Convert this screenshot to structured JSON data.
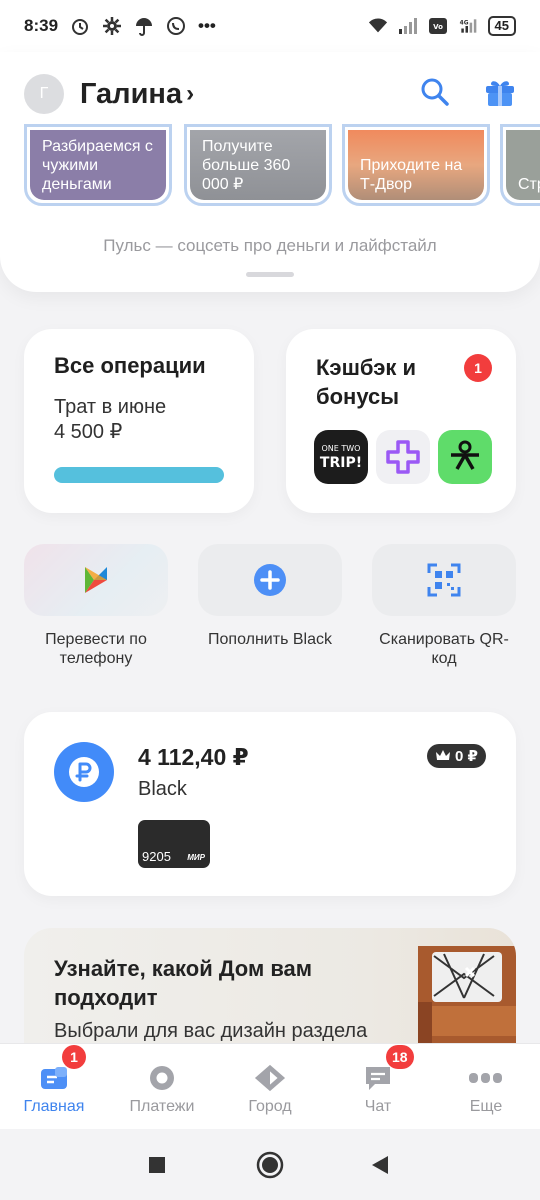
{
  "status_bar": {
    "time": "8:39",
    "ellipsis": "•••",
    "battery": "45",
    "icons": [
      "alarm-icon",
      "gear-icon",
      "umbrella-icon",
      "whatsapp-icon",
      "wifi-icon",
      "signal-icon",
      "volte-icon",
      "signal-4g-icon",
      "battery-icon"
    ]
  },
  "header": {
    "avatar_letter": "Г",
    "user_name": "Галина",
    "chevron": "›"
  },
  "stories": [
    {
      "text": "Разбираемся с чужими деньгами",
      "color": "#8b7ea8"
    },
    {
      "text": "Получите больше 360 000 ₽",
      "color": "#8f9196"
    },
    {
      "text": "Приходите на Т-Двор",
      "color": "#e8a77f"
    },
    {
      "text": "Стр по Рос",
      "color": "#9aa09a"
    }
  ],
  "stories_caption": "Пульс — соцсеть про деньги и лайфстайл",
  "operations_card": {
    "title": "Все операции",
    "subtitle": "Трат в июне",
    "amount": "4 500 ₽",
    "bar_color": "#55c0dd"
  },
  "cashback_card": {
    "title": "Кэшбэк и бонусы",
    "badge": "1",
    "partners": [
      "onetwotrip-logo",
      "plus-logo",
      "lamoda-logo"
    ]
  },
  "quick_actions": [
    {
      "label": "Перевести по телефону",
      "icon": "sbp-icon"
    },
    {
      "label": "Пополнить Black",
      "icon": "plus-circle-icon"
    },
    {
      "label": "Сканировать QR-код",
      "icon": "qr-scan-icon"
    }
  ],
  "account": {
    "amount": "4 112,40 ₽",
    "name": "Black",
    "cashback": "0 ₽",
    "card_number": "9205",
    "card_system": "МИР"
  },
  "promo": {
    "title": "Узнайте, какой Дом вам подходит",
    "subtitle": "Выбрали для вас дизайн раздела"
  },
  "bottom_nav": [
    {
      "label": "Главная",
      "icon": "home-icon",
      "badge": "1",
      "active": true
    },
    {
      "label": "Платежи",
      "icon": "payments-icon",
      "badge": "",
      "active": false
    },
    {
      "label": "Город",
      "icon": "city-icon",
      "badge": "",
      "active": false
    },
    {
      "label": "Чат",
      "icon": "chat-icon",
      "badge": "18",
      "active": false
    },
    {
      "label": "Еще",
      "icon": "more-icon",
      "badge": "",
      "active": false
    }
  ],
  "colors": {
    "accent": "#3f84ee",
    "badge_red": "#f23d3d",
    "account_icon_bg": "#428bf9"
  }
}
